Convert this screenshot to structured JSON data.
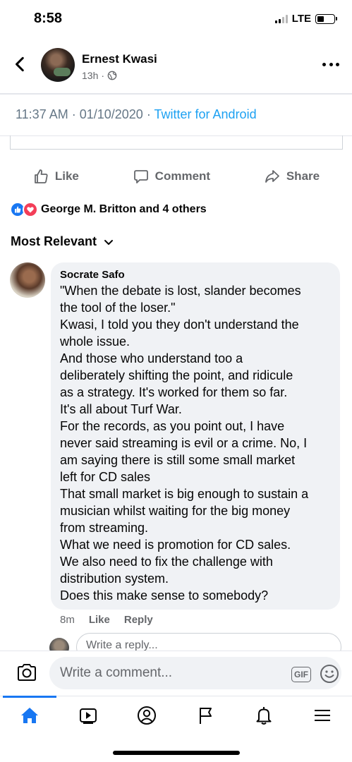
{
  "status_bar": {
    "time": "8:58",
    "network": "LTE"
  },
  "header": {
    "author": "Ernest Kwasi",
    "post_age": "13h",
    "separator": "·"
  },
  "tweet": {
    "time": "11:37 AM",
    "date": "01/10/2020",
    "sep": "·",
    "source": "Twitter for Android"
  },
  "actions": {
    "like": "Like",
    "comment": "Comment",
    "share": "Share"
  },
  "reactions": {
    "summary": "George M. Britton and 4 others"
  },
  "sort": {
    "label": "Most Relevant"
  },
  "comment": {
    "author": "Socrate Safo",
    "lines": [
      "\"When the debate is lost, slander becomes",
      "the tool of the loser.\"",
      "Kwasi, I told you they don't understand the",
      "whole issue.",
      "And those who understand too a",
      "deliberately shifting the point, and ridicule",
      "as a strategy. It's worked for them so far.",
      "It's all about Turf War.",
      "For the records, as you point out, I have",
      "never said streaming is evil  or a crime. No, I",
      "am saying there is still some small market",
      "left for CD sales",
      "That small market is big enough to sustain a",
      "musician whilst waiting for the big money",
      "from streaming.",
      "What we need is promotion for CD sales.",
      "We also need to fix the challenge with",
      "distribution system.",
      "Does this make sense to somebody?"
    ],
    "time": "8m",
    "like": "Like",
    "reply": "Reply"
  },
  "reply_field": {
    "placeholder": "Write a reply..."
  },
  "composer": {
    "placeholder": "Write a comment...",
    "gif": "GIF"
  },
  "colors": {
    "brand_blue": "#1877f2",
    "love_red": "#f33e58",
    "twitter_blue": "#1da1f2",
    "secondary_text": "#65676b",
    "bubble_bg": "#f0f2f5"
  },
  "icons": {
    "back": "chevron-left-icon",
    "more": "more-horizontal-icon",
    "privacy": "globe-icon",
    "like": "thumbs-up-icon",
    "comment": "speech-bubble-icon",
    "share": "share-arrow-icon",
    "sort": "chevron-down-icon",
    "camera": "camera-icon",
    "emoji": "smiley-icon",
    "nav": [
      "home-icon",
      "video-icon",
      "profile-icon",
      "pages-flag-icon",
      "notifications-bell-icon",
      "menu-icon"
    ]
  },
  "nav": {
    "active": "home"
  }
}
